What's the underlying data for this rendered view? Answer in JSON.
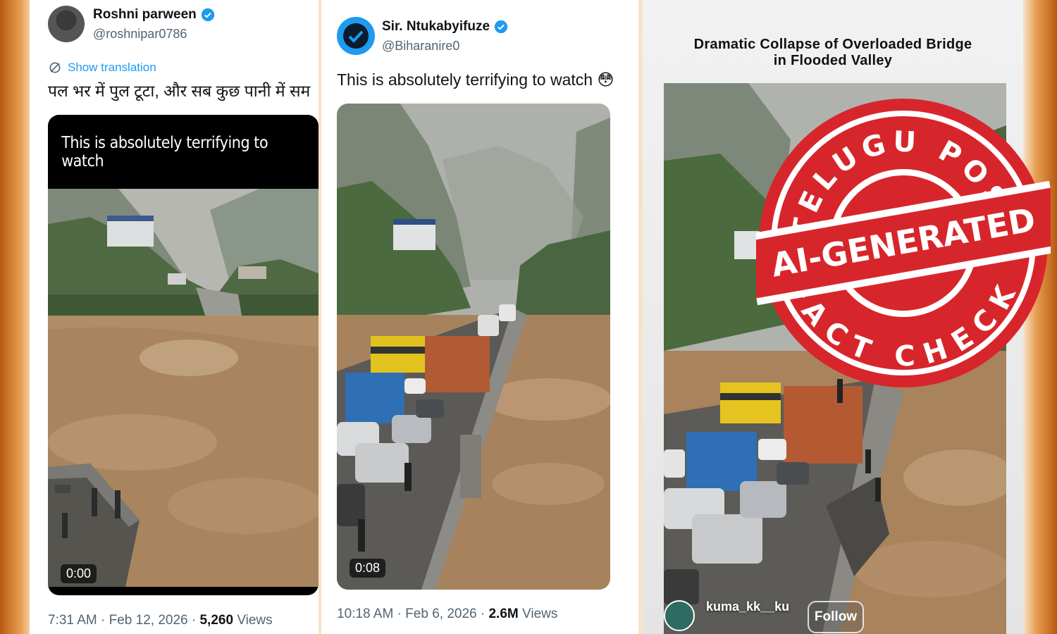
{
  "post1": {
    "user_name": "Roshni parween",
    "handle": "@roshnipar0786",
    "show_translation": "Show translation",
    "text": "पल भर में पुल टूटा, और सब कुछ पानी में सम",
    "video_caption": "This is absolutely terrifying to watch",
    "timer": "0:00",
    "time": "7:31 AM",
    "date": "Feb 12, 2026",
    "views_count": "5,260",
    "views_label": "Views"
  },
  "post2": {
    "user_name": "Sir. Ntukabyifuze",
    "handle": "@Biharanire0",
    "text": "This is absolutely terrifying to watch",
    "emoji": "😳",
    "timer": "0:08",
    "time": "10:18 AM",
    "date": "Feb 6, 2026",
    "views_count": "2.6M",
    "views_label": "Views"
  },
  "post3": {
    "title_line1": "Dramatic Collapse of Overloaded Bridge",
    "title_line2": "in Flooded Valley",
    "username": "kuma_kk__ku",
    "follow_label": "Follow"
  },
  "stamp": {
    "top_text": "TELUGU POST",
    "center_text": "AI-GENERATED",
    "bottom_text": "FACT CHECK",
    "color": "#d7262b"
  },
  "colors": {
    "verified": "#1d9bf0",
    "link": "#1d9bf0",
    "flood_water": "#a98460",
    "mountain": "#6f7c6c"
  },
  "icons": [
    "verified-icon",
    "translate-icon",
    "play-timer"
  ]
}
